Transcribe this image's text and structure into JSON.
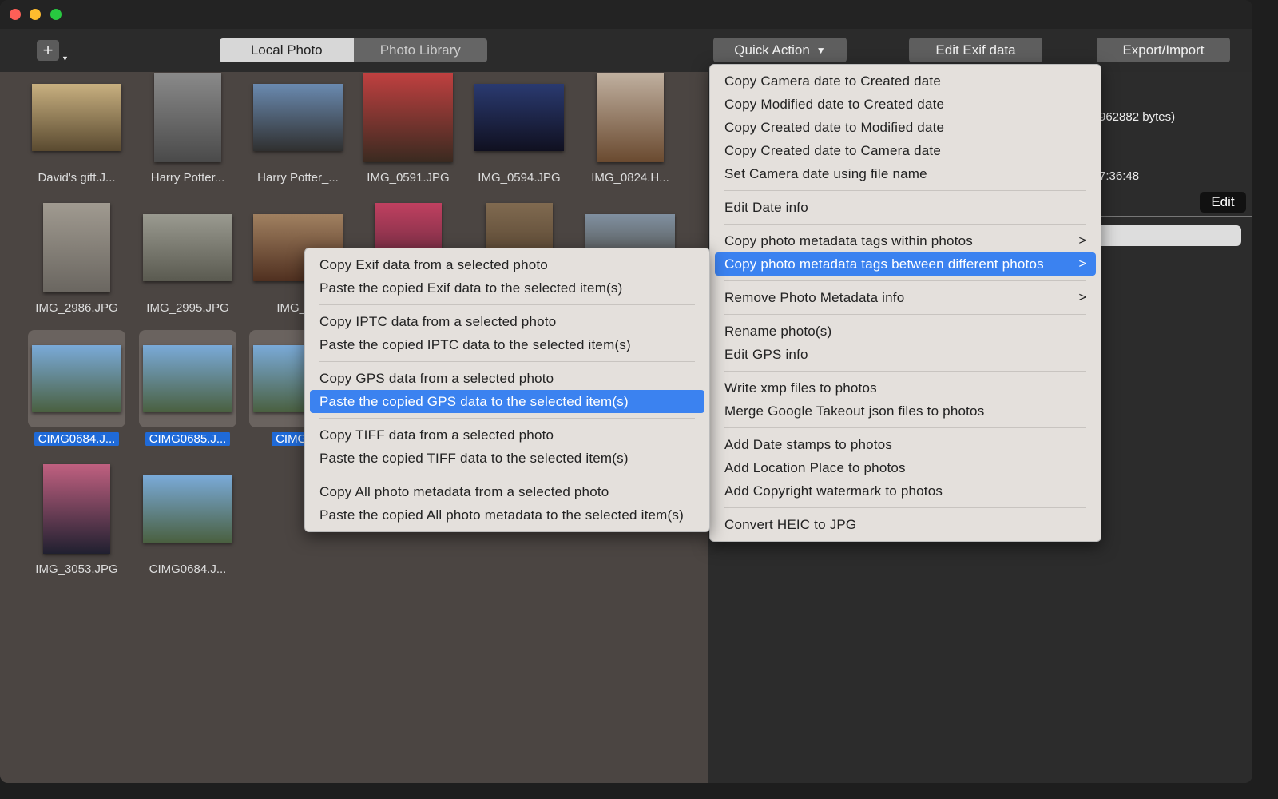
{
  "window": {
    "controls": [
      "close",
      "minimize",
      "zoom"
    ]
  },
  "toolbar": {
    "add_icon": "plus-icon",
    "segments": [
      {
        "label": "Local Photo",
        "selected": true
      },
      {
        "label": "Photo Library",
        "selected": false
      }
    ],
    "quick_action": "Quick Action",
    "edit_exif": "Edit Exif data",
    "export_import": "Export/Import"
  },
  "photos": [
    {
      "label": "David's gift.J...",
      "colors": [
        "#c8b080",
        "#5a4a30"
      ],
      "w": 112,
      "h": 84
    },
    {
      "label": "Harry Potter...",
      "colors": [
        "#8a8a8a",
        "#4a4a4a"
      ],
      "w": 84,
      "h": 112
    },
    {
      "label": "Harry Potter_...",
      "colors": [
        "#6a8ab0",
        "#303030"
      ],
      "w": 112,
      "h": 84
    },
    {
      "label": "IMG_0591.JPG",
      "colors": [
        "#c04040",
        "#3a2a20"
      ],
      "w": 112,
      "h": 112
    },
    {
      "label": "IMG_0594.JPG",
      "colors": [
        "#2a3a70",
        "#101020"
      ],
      "w": 112,
      "h": 84
    },
    {
      "label": "IMG_0824.H...",
      "colors": [
        "#c0b0a0",
        "#6a4a30"
      ],
      "w": 84,
      "h": 112
    },
    {
      "label": "IMG_2986.JPG",
      "colors": [
        "#a09a90",
        "#6a6660"
      ],
      "w": 84,
      "h": 112
    },
    {
      "label": "IMG_2995.JPG",
      "colors": [
        "#9a9a90",
        "#5a5a50"
      ],
      "w": 112,
      "h": 84
    },
    {
      "label": "IMG_30",
      "colors": [
        "#a08060",
        "#503020"
      ],
      "w": 112,
      "h": 84
    },
    {
      "label": "",
      "colors": [
        "#c04060",
        "#402030"
      ],
      "w": 84,
      "h": 112
    },
    {
      "label": "",
      "colors": [
        "#806a50",
        "#403020"
      ],
      "w": 84,
      "h": 112
    },
    {
      "label": "",
      "colors": [
        "#8090a0",
        "#403a30"
      ],
      "w": 112,
      "h": 84
    },
    {
      "label": "CIMG0684.J...",
      "selected": true,
      "colors": [
        "#7aaad8",
        "#4a6040"
      ],
      "w": 112,
      "h": 84
    },
    {
      "label": "CIMG0685.J...",
      "selected": true,
      "colors": [
        "#7aaad8",
        "#4a6040"
      ],
      "w": 112,
      "h": 84
    },
    {
      "label": "CIMG06",
      "selected": true,
      "colors": [
        "#7aaad8",
        "#4a6040"
      ],
      "w": 112,
      "h": 84
    },
    {
      "label": "IMG_3053.JPG",
      "colors": [
        "#c06080",
        "#202030"
      ],
      "w": 84,
      "h": 112
    },
    {
      "label": "CIMG0684.J...",
      "colors": [
        "#7aaad8",
        "#4a6040"
      ],
      "w": 112,
      "h": 84
    }
  ],
  "right_panel": {
    "file_size": "962882 bytes)",
    "time": "7:36:48",
    "edit_button": "Edit"
  },
  "quick_menu": [
    [
      "Copy Camera date to Created date",
      "Copy Modified date to Created date",
      "Copy Created date to Modified date",
      "Copy Created date to Camera date",
      "Set Camera date using file name"
    ],
    [
      "Edit Date info"
    ],
    [
      {
        "label": "Copy photo metadata tags within photos",
        "submenu": true
      },
      {
        "label": "Copy photo metadata tags between different photos",
        "submenu": true,
        "highlighted": true
      }
    ],
    [
      {
        "label": "Remove Photo Metadata info",
        "submenu": true
      }
    ],
    [
      "Rename photo(s)",
      "Edit GPS  info"
    ],
    [
      "Write xmp files to photos",
      "Merge Google Takeout json files to photos"
    ],
    [
      "Add Date stamps to photos",
      "Add Location Place to photos",
      "Add Copyright watermark to photos"
    ],
    [
      "Convert HEIC to JPG"
    ]
  ],
  "sub_menu": [
    [
      "Copy Exif data from a selected photo",
      "Paste the copied Exif data to the selected item(s)"
    ],
    [
      "Copy IPTC data from a selected photo",
      "Paste the copied IPTC data to the selected item(s)"
    ],
    [
      "Copy GPS data from a selected photo",
      {
        "label": "Paste the copied GPS data to the selected item(s)",
        "highlighted": true
      }
    ],
    [
      "Copy TIFF data from a selected photo",
      "Paste the copied TIFF data to the selected item(s)"
    ],
    [
      "Copy All photo metadata from a selected photo",
      "Paste the copied All photo metadata to the selected item(s)"
    ]
  ],
  "colors": {
    "highlight": "#3b82f0",
    "selection": "#1f6ad8",
    "menu_bg": "#e4e0dc"
  }
}
